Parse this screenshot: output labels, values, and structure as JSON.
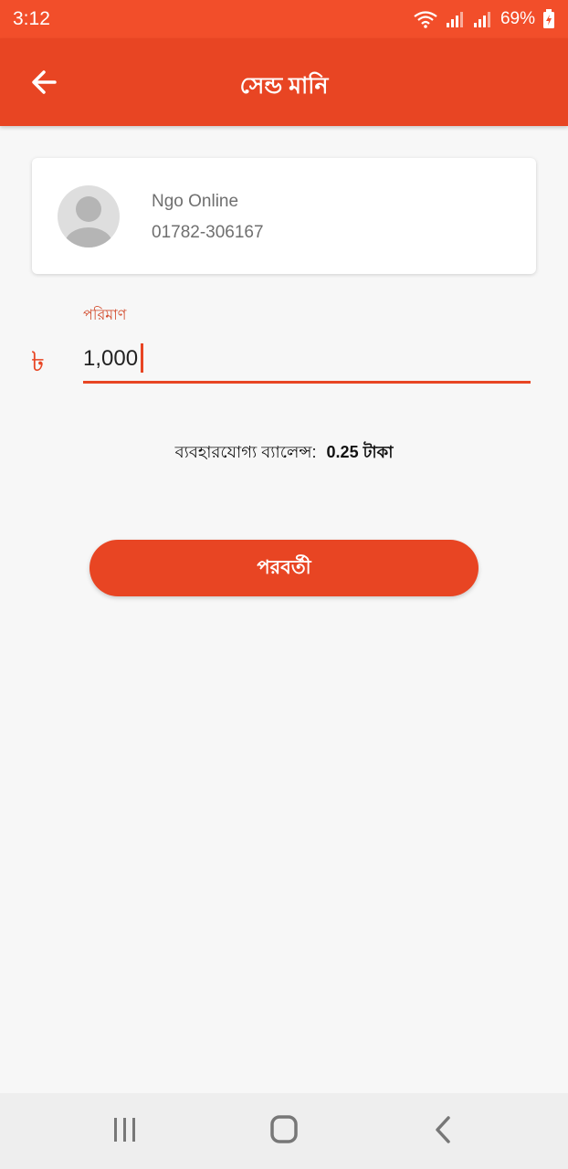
{
  "status_bar": {
    "time": "3:12",
    "battery": "69%",
    "icons": [
      "wifi-icon",
      "signal-icon",
      "signal-icon",
      "battery-charging-icon"
    ]
  },
  "app_bar": {
    "title": "সেন্ড মানি",
    "back_icon": "arrow-left-icon"
  },
  "contact": {
    "name": "Ngo Online",
    "phone": "01782-306167",
    "avatar_icon": "user-placeholder-icon"
  },
  "amount": {
    "label": "পরিমাণ",
    "currency_symbol": "৳",
    "value": "1,000"
  },
  "balance": {
    "label": "ব্যবহারযোগ্য ব্যালেন্স:",
    "value": "0.25 টাকা"
  },
  "next_button": {
    "label": "পরবর্তী"
  },
  "nav_bar": {
    "items": [
      "recent-apps-icon",
      "home-icon",
      "back-icon"
    ]
  },
  "colors": {
    "primary": "#e84523",
    "status_bar": "#f24e2a",
    "background": "#f7f7f7"
  }
}
